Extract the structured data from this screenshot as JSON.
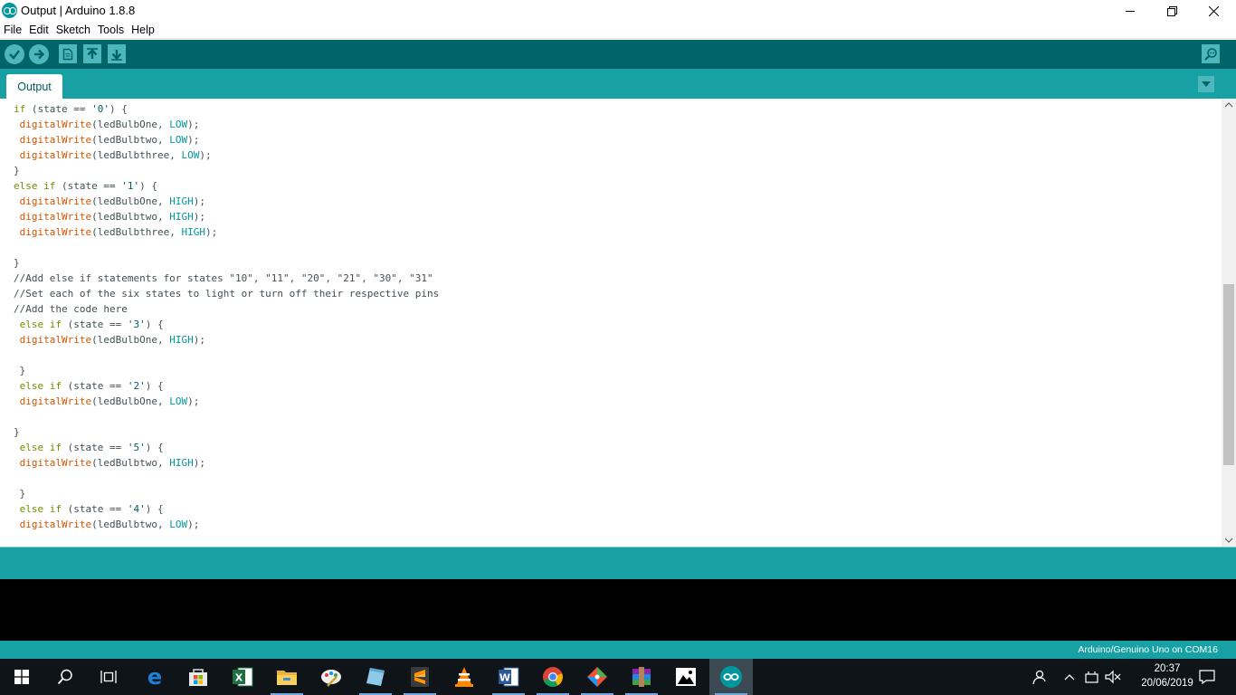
{
  "window": {
    "title": "Output | Arduino 1.8.8"
  },
  "menu": [
    "File",
    "Edit",
    "Sketch",
    "Tools",
    "Help"
  ],
  "toolbar": {
    "buttons": [
      "verify-icon",
      "upload-icon",
      "new-icon",
      "open-icon",
      "save-icon",
      "serial-monitor-icon"
    ]
  },
  "tabs": [
    {
      "label": "Output",
      "active": true
    }
  ],
  "editor": {
    "lines": [
      [
        [
          "kw",
          "if"
        ],
        [
          "t",
          " (state == "
        ],
        [
          "str",
          "'0'"
        ],
        [
          "t",
          ") {"
        ]
      ],
      [
        [
          "t",
          " "
        ],
        [
          "fn",
          "digitalWrite"
        ],
        [
          "t",
          "(ledBulbOne, "
        ],
        [
          "const",
          "LOW"
        ],
        [
          "t",
          ");"
        ]
      ],
      [
        [
          "t",
          " "
        ],
        [
          "fn",
          "digitalWrite"
        ],
        [
          "t",
          "(ledBulbtwo, "
        ],
        [
          "const",
          "LOW"
        ],
        [
          "t",
          ");"
        ]
      ],
      [
        [
          "t",
          " "
        ],
        [
          "fn",
          "digitalWrite"
        ],
        [
          "t",
          "(ledBulbthree, "
        ],
        [
          "const",
          "LOW"
        ],
        [
          "t",
          ");"
        ]
      ],
      [
        [
          "t",
          "}"
        ]
      ],
      [
        [
          "kw",
          "else"
        ],
        [
          "t",
          " "
        ],
        [
          "kw",
          "if"
        ],
        [
          "t",
          " (state == "
        ],
        [
          "str",
          "'1'"
        ],
        [
          "t",
          ") {"
        ]
      ],
      [
        [
          "t",
          " "
        ],
        [
          "fn",
          "digitalWrite"
        ],
        [
          "t",
          "(ledBulbOne, "
        ],
        [
          "const",
          "HIGH"
        ],
        [
          "t",
          ");"
        ]
      ],
      [
        [
          "t",
          " "
        ],
        [
          "fn",
          "digitalWrite"
        ],
        [
          "t",
          "(ledBulbtwo, "
        ],
        [
          "const",
          "HIGH"
        ],
        [
          "t",
          ");"
        ]
      ],
      [
        [
          "t",
          " "
        ],
        [
          "fn",
          "digitalWrite"
        ],
        [
          "t",
          "(ledBulbthree, "
        ],
        [
          "const",
          "HIGH"
        ],
        [
          "t",
          ");"
        ]
      ],
      [
        [
          "t",
          ""
        ]
      ],
      [
        [
          "t",
          "}"
        ]
      ],
      [
        [
          "cm",
          "//Add else if statements for states \"10\", \"11\", \"20\", \"21\", \"30\", \"31\""
        ]
      ],
      [
        [
          "cm",
          "//Set each of the six states to light or turn off their respective pins"
        ]
      ],
      [
        [
          "cm",
          "//Add the code here"
        ]
      ],
      [
        [
          "t",
          " "
        ],
        [
          "kw",
          "else"
        ],
        [
          "t",
          " "
        ],
        [
          "kw",
          "if"
        ],
        [
          "t",
          " (state == "
        ],
        [
          "str",
          "'3'"
        ],
        [
          "t",
          ") {"
        ]
      ],
      [
        [
          "t",
          " "
        ],
        [
          "fn",
          "digitalWrite"
        ],
        [
          "t",
          "(ledBulbOne, "
        ],
        [
          "const",
          "HIGH"
        ],
        [
          "t",
          ");"
        ]
      ],
      [
        [
          "t",
          ""
        ]
      ],
      [
        [
          "t",
          " }"
        ]
      ],
      [
        [
          "t",
          " "
        ],
        [
          "kw",
          "else"
        ],
        [
          "t",
          " "
        ],
        [
          "kw",
          "if"
        ],
        [
          "t",
          " (state == "
        ],
        [
          "str",
          "'2'"
        ],
        [
          "t",
          ") {"
        ]
      ],
      [
        [
          "t",
          " "
        ],
        [
          "fn",
          "digitalWrite"
        ],
        [
          "t",
          "(ledBulbOne, "
        ],
        [
          "const",
          "LOW"
        ],
        [
          "t",
          ");"
        ]
      ],
      [
        [
          "t",
          ""
        ]
      ],
      [
        [
          "t",
          "}"
        ]
      ],
      [
        [
          "t",
          " "
        ],
        [
          "kw",
          "else"
        ],
        [
          "t",
          " "
        ],
        [
          "kw",
          "if"
        ],
        [
          "t",
          " (state == "
        ],
        [
          "str",
          "'5'"
        ],
        [
          "t",
          ") {"
        ]
      ],
      [
        [
          "t",
          " "
        ],
        [
          "fn",
          "digitalWrite"
        ],
        [
          "t",
          "(ledBulbtwo, "
        ],
        [
          "const",
          "HIGH"
        ],
        [
          "t",
          ");"
        ]
      ],
      [
        [
          "t",
          ""
        ]
      ],
      [
        [
          "t",
          " }"
        ]
      ],
      [
        [
          "t",
          " "
        ],
        [
          "kw",
          "else"
        ],
        [
          "t",
          " "
        ],
        [
          "kw",
          "if"
        ],
        [
          "t",
          " (state == "
        ],
        [
          "str",
          "'4'"
        ],
        [
          "t",
          ") {"
        ]
      ],
      [
        [
          "t",
          " "
        ],
        [
          "fn",
          "digitalWrite"
        ],
        [
          "t",
          "(ledBulbtwo, "
        ],
        [
          "const",
          "LOW"
        ],
        [
          "t",
          ");"
        ]
      ]
    ]
  },
  "statusbar": {
    "board": "Arduino/Genuino Uno on COM16"
  },
  "taskbar": {
    "apps": [
      "start-icon",
      "search-icon",
      "task-view-icon",
      "edge-icon",
      "store-icon",
      "excel-icon",
      "file-explorer-icon",
      "paint-icon",
      "notepad-icon",
      "sublime-text-icon",
      "vlc-icon",
      "word-icon",
      "chrome-icon",
      "git-icon",
      "winrar-icon",
      "photos-icon",
      "arduino-icon"
    ],
    "time": "20:37",
    "date": "20/06/2019"
  },
  "colors": {
    "toolbar": "#006468",
    "tabs": "#17a1a5",
    "keyword": "#728e00",
    "function": "#d35400",
    "constant": "#00979c"
  }
}
